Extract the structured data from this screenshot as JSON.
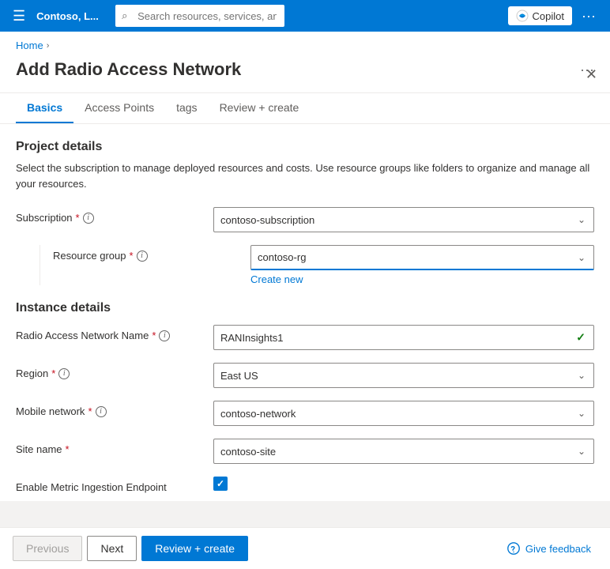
{
  "navbar": {
    "hamburger": "☰",
    "brand": "Contoso, L...",
    "search_placeholder": "Search resources, services, and docs (G+/)",
    "search_icon": "🔍",
    "copilot_label": "Copilot",
    "dots": "···"
  },
  "breadcrumb": {
    "home": "Home",
    "separator": "›"
  },
  "page": {
    "title": "Add Radio Access Network",
    "dots": "···",
    "close_icon": "✕"
  },
  "tabs": [
    {
      "id": "basics",
      "label": "Basics",
      "active": true
    },
    {
      "id": "access-points",
      "label": "Access Points",
      "active": false
    },
    {
      "id": "tags",
      "label": "tags",
      "active": false
    },
    {
      "id": "review-create",
      "label": "Review + create",
      "active": false
    }
  ],
  "form": {
    "project_details_title": "Project details",
    "project_details_desc": "Select the subscription to manage deployed resources and costs. Use resource groups like folders to organize and manage all your resources.",
    "subscription_label": "Subscription",
    "subscription_value": "contoso-subscription",
    "resource_group_label": "Resource group",
    "resource_group_value": "contoso-rg",
    "create_new_label": "Create new",
    "instance_details_title": "Instance details",
    "ran_name_label": "Radio Access Network Name",
    "ran_name_value": "RANInsights1",
    "region_label": "Region",
    "region_value": "East US",
    "mobile_network_label": "Mobile network",
    "mobile_network_value": "contoso-network",
    "site_name_label": "Site name",
    "site_name_value": "contoso-site",
    "enable_metric_label": "Enable Metric Ingestion Endpoint"
  },
  "footer": {
    "previous_label": "Previous",
    "next_label": "Next",
    "review_create_label": "Review + create",
    "give_feedback_label": "Give feedback"
  }
}
